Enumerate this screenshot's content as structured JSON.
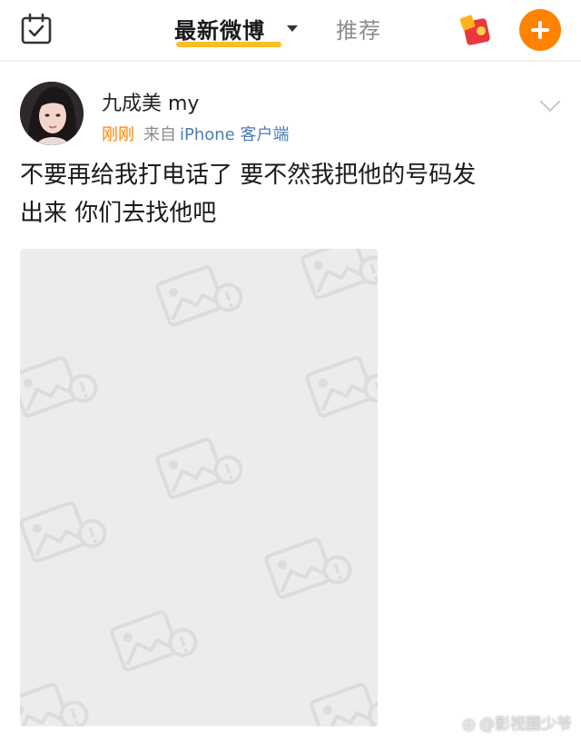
{
  "header": {
    "checkin_icon": "calendar-check-icon",
    "tab_latest": "最新微博",
    "tab_recommend": "推荐",
    "redpacket_icon": "red-packet-icon",
    "compose_icon": "plus-icon",
    "accent_color": "#ff8200"
  },
  "post": {
    "username": "九成美 my",
    "time": "刚刚",
    "source_prefix": "来自",
    "source_client": "iPhone 客户端",
    "text_line1": "不要再给我打电话了 要不然我把他的号码发",
    "text_line2": "出来 你们去找他吧",
    "menu_icon": "chevron-down-icon",
    "image_placeholder_icon": "image-placeholder-icon"
  },
  "watermark": {
    "text": "@影视圈少爷"
  }
}
